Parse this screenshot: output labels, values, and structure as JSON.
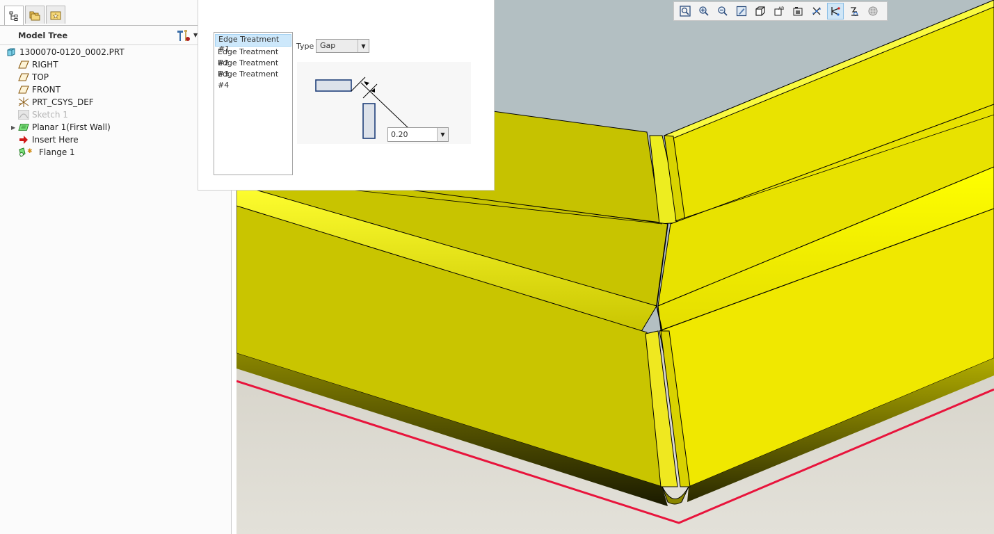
{
  "navigator": {
    "tabs": [
      {
        "name": "model-tree-tab",
        "icon": "tree-hierarchy-icon",
        "active": true
      },
      {
        "name": "folder-browser-tab",
        "icon": "folders-icon",
        "active": false
      },
      {
        "name": "favorites-tab",
        "icon": "favorites-icon",
        "active": false
      }
    ],
    "title": "Model Tree",
    "items": [
      {
        "label": "1300070-0120_0002.PRT",
        "icon": "part-icon",
        "indent": 0,
        "expander": false,
        "dim": false
      },
      {
        "label": "RIGHT",
        "icon": "datum-plane-icon",
        "indent": 1,
        "expander": false,
        "dim": false
      },
      {
        "label": "TOP",
        "icon": "datum-plane-icon",
        "indent": 1,
        "expander": false,
        "dim": false
      },
      {
        "label": "FRONT",
        "icon": "datum-plane-icon",
        "indent": 1,
        "expander": false,
        "dim": false
      },
      {
        "label": "PRT_CSYS_DEF",
        "icon": "coordinate-system-icon",
        "indent": 1,
        "expander": false,
        "dim": false
      },
      {
        "label": "Sketch 1",
        "icon": "sketch-icon",
        "indent": 1,
        "expander": false,
        "dim": true
      },
      {
        "label": "Planar 1(First Wall)",
        "icon": "planar-wall-icon",
        "indent": 1,
        "expander": true,
        "dim": false
      },
      {
        "label": "Insert Here",
        "icon": "insert-here-arrow-icon",
        "indent": 1,
        "expander": false,
        "dim": false
      },
      {
        "label": "Flange 1",
        "icon": "flange-icon",
        "indent": 1,
        "expander": false,
        "dim": false
      }
    ]
  },
  "panel": {
    "treatments": [
      "Edge Treatment #1",
      "Edge Treatment #2",
      "Edge Treatment #3",
      "Edge Treatment #4"
    ],
    "selected_index": 0,
    "type_label": "Type",
    "type_value": "Gap",
    "gap_value": "0.20"
  },
  "toolbar": {
    "buttons": [
      {
        "name": "refit-button",
        "icon": "refit-icon",
        "on": false
      },
      {
        "name": "zoom-in-button",
        "icon": "zoom-in-icon",
        "on": false
      },
      {
        "name": "zoom-out-button",
        "icon": "zoom-out-icon",
        "on": false
      },
      {
        "name": "repaint-button",
        "icon": "repaint-icon",
        "on": false
      },
      {
        "name": "display-style-button",
        "icon": "display-style-icon",
        "on": false
      },
      {
        "name": "saved-orientations-button",
        "icon": "saved-views-icon",
        "on": false
      },
      {
        "name": "view-manager-button",
        "icon": "view-manager-icon",
        "on": false
      },
      {
        "name": "datum-display-button",
        "icon": "datum-display-icon",
        "on": false
      },
      {
        "name": "annotation-display-button",
        "icon": "annotation-display-icon",
        "on": true
      },
      {
        "name": "spin-center-button",
        "icon": "spin-center-icon",
        "on": false
      },
      {
        "name": "appearance-button",
        "icon": "appearance-icon",
        "on": false
      }
    ]
  },
  "colors": {
    "part_yellow": "#f0e800",
    "part_shade": "#c8c400",
    "part_dark": "#6b6900",
    "sky": "#b3bfc2",
    "floor": "#dcd9cf",
    "flat_pattern_edge": "#e8143c",
    "selection_blue": "#cde8fb"
  }
}
